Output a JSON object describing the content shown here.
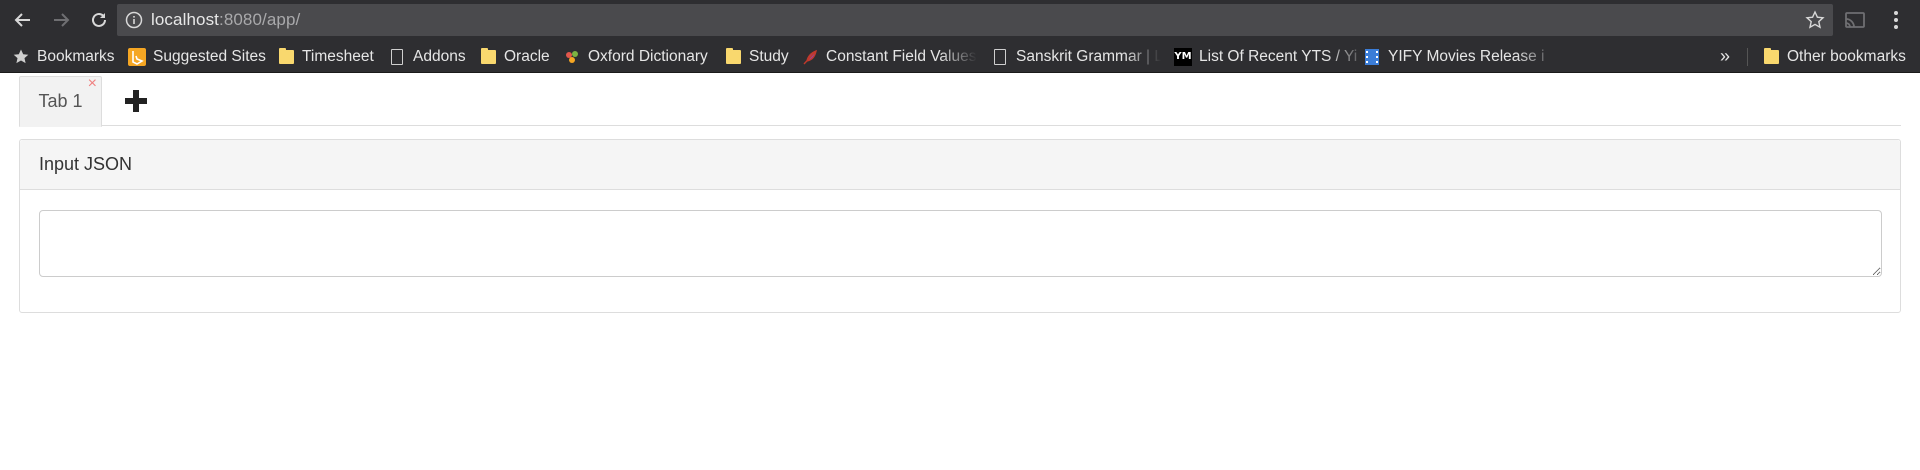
{
  "browser": {
    "url_host": "localhost",
    "url_rest": ":8080/app/",
    "bookmarks": [
      {
        "label": "Bookmarks",
        "icon": "star-icon"
      },
      {
        "label": "Suggested Sites",
        "icon": "bing-icon"
      },
      {
        "label": "Timesheet",
        "icon": "folder-icon"
      },
      {
        "label": "Addons",
        "icon": "page-icon"
      },
      {
        "label": "Oracle",
        "icon": "folder-icon"
      },
      {
        "label": "Oxford Dictionary",
        "icon": "oxford-icon"
      },
      {
        "label": "Study",
        "icon": "folder-icon"
      },
      {
        "label": "Constant Field Values",
        "icon": "feather-icon"
      },
      {
        "label": "Sanskrit Grammar | Le",
        "icon": "page-icon"
      },
      {
        "label": "List Of Recent YTS / Yi",
        "icon": "ym-icon",
        "icon_text": "YM"
      },
      {
        "label": "YIFY Movies Release i",
        "icon": "film-icon"
      }
    ],
    "overflow_label": "»",
    "other_bookmarks": "Other bookmarks"
  },
  "tabs": [
    {
      "label": "Tab 1",
      "close": "×"
    }
  ],
  "panel": {
    "heading": "Input JSON",
    "input_value": ""
  },
  "colors": {
    "chrome": "#2e2e31",
    "omnibox": "#4a4a4d",
    "folder": "#f9d86e",
    "tab_close": "#f08080"
  }
}
